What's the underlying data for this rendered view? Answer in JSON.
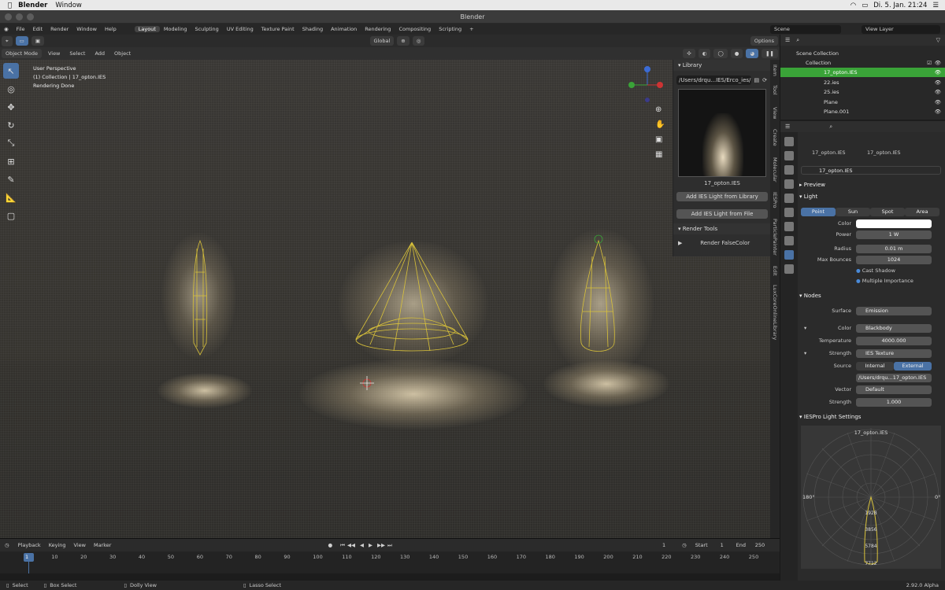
{
  "mac_menubar": {
    "apple_icon": "apple-icon",
    "app": "Blender",
    "menu": [
      "Window"
    ],
    "status": "Di. 5. Jan.  21:24"
  },
  "window_title": "Blender",
  "menu": [
    "File",
    "Edit",
    "Render",
    "Window",
    "Help"
  ],
  "workspaces": [
    "Layout",
    "Modeling",
    "Sculpting",
    "UV Editing",
    "Texture Paint",
    "Shading",
    "Animation",
    "Rendering",
    "Compositing",
    "Scripting"
  ],
  "active_workspace": "Layout",
  "scene": "Scene",
  "view_layer": "View Layer",
  "viewport": {
    "mode": "Object Mode",
    "menu": [
      "View",
      "Select",
      "Add",
      "Object"
    ],
    "transform": "Global",
    "options": "Options",
    "info": [
      "User Perspective",
      "(1) Collection | 17_opton.IES",
      "Rendering Done"
    ]
  },
  "library": {
    "header": "Library",
    "path": "/Users/drqu...IES/Erco_ies/",
    "preview_name": "17_opton.IES",
    "add_lib_button": "Add IES Light from Library",
    "add_file_button": "Add IES Light from File",
    "render_tools": "Render Tools",
    "render_falsecolor": "Render FalseColor"
  },
  "side_tabs": [
    "Item",
    "Tool",
    "View",
    "Create",
    "Molecular",
    "IESPro",
    "ParticlePainter",
    "Edit",
    "LuxCoreOnlineLibrary"
  ],
  "outliner": {
    "root": "Scene Collection",
    "collection": "Collection",
    "items": [
      "17_opton.IES",
      "22.ies",
      "25.ies",
      "Plane",
      "Plane.001"
    ],
    "active": "17_opton.IES"
  },
  "properties": {
    "object": "17_opton.IES",
    "data": "17_opton.IES",
    "datablock": "17_opton.IES",
    "preview": "Preview",
    "light": "Light",
    "light_types": [
      "Point",
      "Sun",
      "Spot",
      "Area"
    ],
    "active_type": "Point",
    "color_label": "Color",
    "power_label": "Power",
    "power": "1 W",
    "radius_label": "Radius",
    "radius": "0.01 m",
    "bounces_label": "Max Bounces",
    "bounces": "1024",
    "cast_shadow": "Cast Shadow",
    "multiple_importance": "Multiple Importance",
    "nodes": "Nodes",
    "surface_label": "Surface",
    "surface": "Emission",
    "color2_label": "Color",
    "color2": "Blackbody",
    "temperature_label": "Temperature",
    "temperature": "4000.000",
    "strength_label": "Strength",
    "strength_node": "IES Texture",
    "source_label": "Source",
    "source_internal": "Internal",
    "source_external": "External",
    "file": "/Users/drqu...17_opton.IES",
    "vector_label": "Vector",
    "vector": "Default",
    "strength2_label": "Strength",
    "strength2": "1.000",
    "iespro_settings": "IESPro Light Settings",
    "polar": {
      "title": "17_opton.IES",
      "left": "180°",
      "right": "0°",
      "values": [
        "1928",
        "3856",
        "5784",
        "7712"
      ]
    }
  },
  "timeline": {
    "menu": [
      "Playback",
      "Keying",
      "View",
      "Marker"
    ],
    "current": "1",
    "start_label": "Start",
    "start": "1",
    "end_label": "End",
    "end": "250",
    "frames": [
      "1",
      "10",
      "20",
      "30",
      "40",
      "50",
      "60",
      "70",
      "80",
      "90",
      "100",
      "110",
      "120",
      "130",
      "140",
      "150",
      "160",
      "170",
      "180",
      "190",
      "200",
      "210",
      "220",
      "230",
      "240",
      "250"
    ]
  },
  "status_bar": {
    "select": "Select",
    "box_select": "Box Select",
    "dolly": "Dolly View",
    "lasso": "Lasso Select",
    "version": "2.92.0 Alpha"
  },
  "colors": {
    "accent_blue": "#4a72a5",
    "active_green": "#3aa338",
    "wireframe": "#d9c23a"
  }
}
